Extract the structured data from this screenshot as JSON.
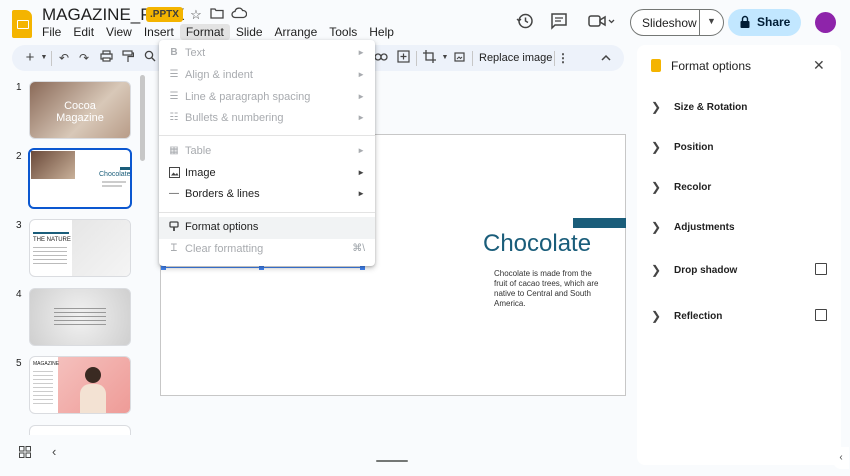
{
  "app": {
    "doc_title": "MAGAZINE_PPTX",
    "file_badge": ".PPTX",
    "menu": [
      "File",
      "Edit",
      "View",
      "Insert",
      "Format",
      "Slide",
      "Arrange",
      "Tools",
      "Help"
    ],
    "active_menu": "Format"
  },
  "header": {
    "slideshow_label": "Slideshow",
    "share_label": "Share"
  },
  "toolbar": {
    "replace_image_label": "Replace image"
  },
  "filmstrip": {
    "slides": [
      {
        "num": "1",
        "title": "Cocoa Magazine"
      },
      {
        "num": "2",
        "title": "Chocolate"
      },
      {
        "num": "3",
        "title": "THE NATURE"
      },
      {
        "num": "4",
        "title": ""
      },
      {
        "num": "5",
        "title": "MAGAZINE"
      }
    ]
  },
  "slide": {
    "title": "Chocolate",
    "body": "Chocolate is made from the fruit of cacao trees, which are native to Central and South America."
  },
  "format_menu": {
    "items": [
      {
        "label": "Text",
        "icon": "bold-icon",
        "disabled": true,
        "submenu": true
      },
      {
        "label": "Align & indent",
        "icon": "align-icon",
        "disabled": true,
        "submenu": true
      },
      {
        "label": "Line & paragraph spacing",
        "icon": "line-spacing-icon",
        "disabled": true,
        "submenu": true
      },
      {
        "label": "Bullets & numbering",
        "icon": "bullets-icon",
        "disabled": true,
        "submenu": true
      },
      {
        "label": "Table",
        "icon": "table-icon",
        "disabled": true,
        "submenu": true
      },
      {
        "label": "Image",
        "icon": "image-icon",
        "disabled": false,
        "submenu": true
      },
      {
        "label": "Borders & lines",
        "icon": "border-line-icon",
        "disabled": false,
        "submenu": true
      },
      {
        "label": "Format options",
        "icon": "format-options-icon",
        "disabled": false,
        "submenu": false
      },
      {
        "label": "Clear formatting",
        "icon": "clear-format-icon",
        "disabled": true,
        "shortcut": "⌘\\"
      }
    ]
  },
  "format_panel": {
    "title": "Format options",
    "sections": [
      {
        "label": "Size & Rotation",
        "checkbox": false
      },
      {
        "label": "Position",
        "checkbox": false
      },
      {
        "label": "Recolor",
        "checkbox": false
      },
      {
        "label": "Adjustments",
        "checkbox": false
      },
      {
        "label": "Drop shadow",
        "checkbox": true
      },
      {
        "label": "Reflection",
        "checkbox": true
      }
    ]
  },
  "colors": {
    "accent_blue": "#0b57d0",
    "share_bg": "#c2e7ff",
    "slide_teal": "#1a5d7a",
    "logo_yellow": "#f4b400",
    "avatar": "#8e24aa"
  }
}
